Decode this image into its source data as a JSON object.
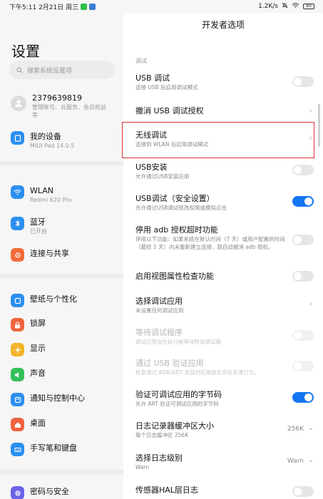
{
  "status_bar": {
    "time_date": "下午5:11 2月21日 周三",
    "network_speed": "1.2K/s",
    "battery": "40",
    "app_icons": [
      "#2fbf4a",
      "#3a7bd5"
    ]
  },
  "left_panel": {
    "title": "设置",
    "search_placeholder": "搜索系统设置项",
    "account": {
      "name": "2379639819",
      "sub": "管理账号、云服务、会员权益等"
    },
    "items": [
      {
        "label": "我的设备",
        "sub": "MIUI Pad 14.0.5",
        "icon": "tablet-icon",
        "color": "#2b8ff0"
      },
      {
        "label": "WLAN",
        "sub": "Redmi K20 Pro",
        "icon": "wifi-icon",
        "color": "#2b8ff0"
      },
      {
        "label": "蓝牙",
        "sub": "已开启",
        "icon": "bluetooth-icon",
        "color": "#2b8ff0"
      },
      {
        "label": "连接与共享",
        "sub": "",
        "icon": "share-icon",
        "color": "#f26b3a"
      },
      {
        "label": "壁纸与个性化",
        "sub": "",
        "icon": "palette-icon",
        "color": "#2b8ff0"
      },
      {
        "label": "锁屏",
        "sub": "",
        "icon": "lock-icon",
        "color": "#f0643e"
      },
      {
        "label": "显示",
        "sub": "",
        "icon": "sun-icon",
        "color": "#f3b429"
      },
      {
        "label": "声音",
        "sub": "",
        "icon": "speaker-icon",
        "color": "#35c05a"
      },
      {
        "label": "通知与控制中心",
        "sub": "",
        "icon": "bell-icon",
        "color": "#2b8ff0"
      },
      {
        "label": "桌面",
        "sub": "",
        "icon": "home-icon",
        "color": "#f0643e"
      },
      {
        "label": "手写笔和键盘",
        "sub": "",
        "icon": "keyboard-icon",
        "color": "#2b8ff0"
      },
      {
        "label": "密码与安全",
        "sub": "",
        "icon": "fingerprint-icon",
        "color": "#6b63e8"
      }
    ]
  },
  "right_panel": {
    "title": "开发者选项",
    "section": "调试",
    "rows": [
      {
        "title": "USB 调试",
        "sub": "连接 USB 后启用调试模式",
        "control": "toggle",
        "state": "off"
      },
      {
        "title": "撤消 USB 调试授权",
        "sub": "",
        "control": "chevron"
      },
      {
        "title": "无线调试",
        "sub": "连接到 WLAN 后启用调试模式",
        "control": "chevron"
      },
      {
        "title": "USB安装",
        "sub": "允许通过USB安装应用",
        "control": "toggle",
        "state": "off"
      },
      {
        "title": "USB调试（安全设置）",
        "sub": "允许通过USB调试修改权限或模拟点击",
        "control": "toggle",
        "state": "on"
      },
      {
        "title": "停用 adb 授权超时功能",
        "sub": "停用以下功能：如果系统在默认时间（7 天）或用户配置的时间（最短 1 天）内未重新建立连接，就自动撤消 adb 授权。",
        "control": "toggle",
        "state": "off"
      },
      {
        "title": "启用视图属性检查功能",
        "sub": "",
        "control": "toggle",
        "state": "off"
      },
      {
        "title": "选择调试应用",
        "sub": "未设置任何调试应用",
        "control": "chevron"
      },
      {
        "title": "等待调试程序",
        "sub": "调试应用会在执行前等待附加调试器",
        "control": "toggle",
        "state": "disabled"
      },
      {
        "title": "通过 USB 验证应用",
        "sub": "检查通过 ADB/ADT 安装的应用是否存在有害行为。",
        "control": "toggle",
        "state": "disabled"
      },
      {
        "title": "验证可调试应用的字节码",
        "sub": "允许 ART 验证可调试应用的字节码",
        "control": "toggle",
        "state": "on"
      },
      {
        "title": "日志记录器缓冲区大小",
        "sub": "每个日志缓冲区 256K",
        "control": "value",
        "value": "256K"
      },
      {
        "title": "选择日志级别",
        "sub": "Warn",
        "control": "value",
        "value": "Warn"
      },
      {
        "title": "传感器HAL层日志",
        "sub": "",
        "control": "toggle",
        "state": "off"
      }
    ]
  },
  "colors": {
    "accent": "#1476f0",
    "highlight": "#e0322f"
  }
}
